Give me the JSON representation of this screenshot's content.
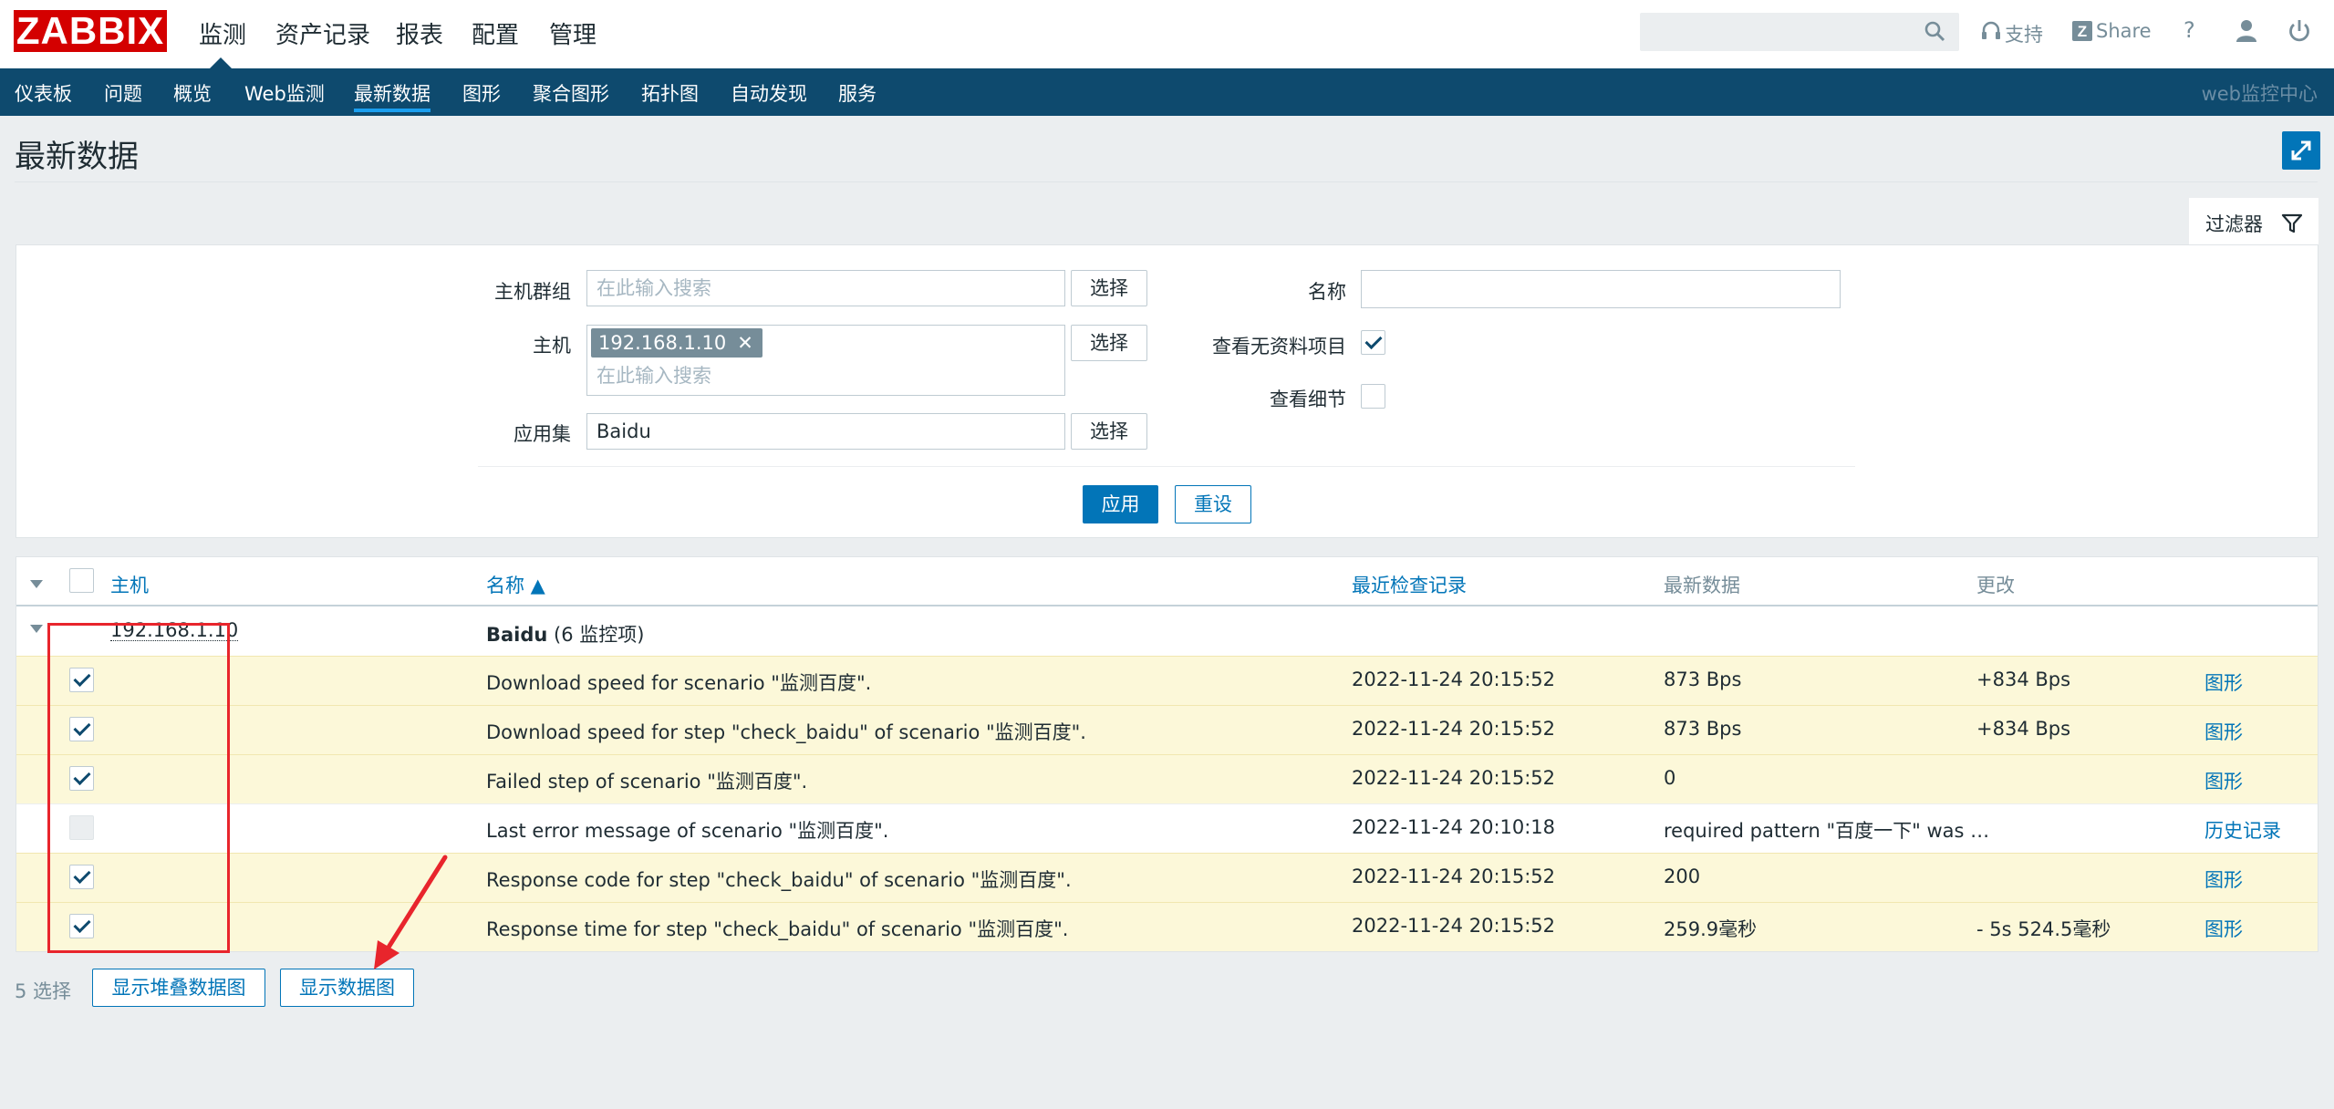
{
  "header": {
    "logo": "ZABBIX",
    "main_menu": [
      "监测",
      "资产记录",
      "报表",
      "配置",
      "管理"
    ],
    "search_value": "",
    "support_label": "支持",
    "share_label": "Share",
    "help_label": "?"
  },
  "submenu": {
    "items": [
      "仪表板",
      "问题",
      "概览",
      "Web监测",
      "最新数据",
      "图形",
      "聚合图形",
      "拓扑图",
      "自动发现",
      "服务"
    ],
    "active": "最新数据",
    "right_label": "web监控中心"
  },
  "page": {
    "title": "最新数据"
  },
  "filter": {
    "tab_label": "过滤器",
    "host_group_label": "主机群组",
    "host_group_placeholder": "在此输入搜索",
    "host_label": "主机",
    "host_tag": "192.168.1.10",
    "host_placeholder": "在此输入搜索",
    "app_label": "应用集",
    "app_value": "Baidu",
    "select_label": "选择",
    "name_label": "名称",
    "name_value": "",
    "show_no_data_label": "查看无资料项目",
    "show_no_data_checked": true,
    "show_details_label": "查看细节",
    "show_details_checked": false,
    "apply_label": "应用",
    "reset_label": "重设"
  },
  "table": {
    "headers": {
      "host": "主机",
      "name": "名称 ▲",
      "last_check": "最近检查记录",
      "last_value": "最新数据",
      "change": "更改"
    },
    "group": {
      "host": "192.168.1.10",
      "name": "Baidu",
      "count": "(6 监控项)"
    },
    "rows": [
      {
        "checked": true,
        "name": "Download speed for scenario \"监测百度\".",
        "last_check": "2022-11-24 20:15:52",
        "last_value": "873 Bps",
        "change": "+834 Bps",
        "action": "图形"
      },
      {
        "checked": true,
        "name": "Download speed for step \"check_baidu\" of scenario \"监测百度\".",
        "last_check": "2022-11-24 20:15:52",
        "last_value": "873 Bps",
        "change": "+834 Bps",
        "action": "图形"
      },
      {
        "checked": true,
        "name": "Failed step of scenario \"监测百度\".",
        "last_check": "2022-11-24 20:15:52",
        "last_value": "0",
        "change": "",
        "action": "图形"
      },
      {
        "checked": false,
        "name": "Last error message of scenario \"监测百度\".",
        "last_check": "2022-11-24 20:10:18",
        "last_value": "required pattern \"百度一下\" was …",
        "change": "",
        "action": "历史记录"
      },
      {
        "checked": true,
        "name": "Response code for step \"check_baidu\" of scenario \"监测百度\".",
        "last_check": "2022-11-24 20:15:52",
        "last_value": "200",
        "change": "",
        "action": "图形"
      },
      {
        "checked": true,
        "name": "Response time for step \"check_baidu\" of scenario \"监测百度\".",
        "last_check": "2022-11-24 20:15:52",
        "last_value": "259.9毫秒",
        "change": "- 5s 524.5毫秒",
        "action": "图形"
      }
    ]
  },
  "footer": {
    "selected": "5 选择",
    "stacked_graph_label": "显示堆叠数据图",
    "graph_label": "显示数据图"
  },
  "colors": {
    "brand": "#d40000",
    "nav": "#0e4a6e",
    "accent": "#0275b8",
    "highlight_row": "#fcf8d9",
    "annotation": "#e8252c"
  }
}
